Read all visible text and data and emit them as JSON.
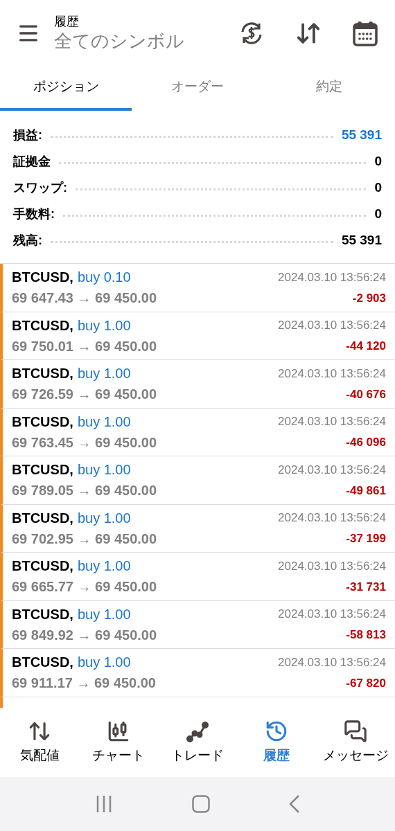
{
  "header": {
    "title": "履歴",
    "subtitle": "全てのシンボル"
  },
  "tabs": [
    {
      "label": "ポジション",
      "selected": true
    },
    {
      "label": "オーダー",
      "selected": false
    },
    {
      "label": "約定",
      "selected": false
    }
  ],
  "summary": [
    {
      "label": "損益:",
      "value": "55 391",
      "color": "#1976d2"
    },
    {
      "label": "証拠金",
      "value": "0",
      "color": "#000000"
    },
    {
      "label": "スワップ:",
      "value": "0",
      "color": "#000000"
    },
    {
      "label": "手数料:",
      "value": "0",
      "color": "#000000"
    },
    {
      "label": "残高:",
      "value": "55 391",
      "color": "#000000"
    }
  ],
  "deals": [
    {
      "symbol": "BTCUSD,",
      "side": "buy 0.10",
      "prices": "69 647.43 → 69 450.00",
      "time": "2024.03.10 13:56:24",
      "profit": "-2 903"
    },
    {
      "symbol": "BTCUSD,",
      "side": "buy 1.00",
      "prices": "69 750.01 → 69 450.00",
      "time": "2024.03.10 13:56:24",
      "profit": "-44 120"
    },
    {
      "symbol": "BTCUSD,",
      "side": "buy 1.00",
      "prices": "69 726.59 → 69 450.00",
      "time": "2024.03.10 13:56:24",
      "profit": "-40 676"
    },
    {
      "symbol": "BTCUSD,",
      "side": "buy 1.00",
      "prices": "69 763.45 → 69 450.00",
      "time": "2024.03.10 13:56:24",
      "profit": "-46 096"
    },
    {
      "symbol": "BTCUSD,",
      "side": "buy 1.00",
      "prices": "69 789.05 → 69 450.00",
      "time": "2024.03.10 13:56:24",
      "profit": "-49 861"
    },
    {
      "symbol": "BTCUSD,",
      "side": "buy 1.00",
      "prices": "69 702.95 → 69 450.00",
      "time": "2024.03.10 13:56:24",
      "profit": "-37 199"
    },
    {
      "symbol": "BTCUSD,",
      "side": "buy 1.00",
      "prices": "69 665.77 → 69 450.00",
      "time": "2024.03.10 13:56:24",
      "profit": "-31 731"
    },
    {
      "symbol": "BTCUSD,",
      "side": "buy 1.00",
      "prices": "69 849.92 → 69 450.00",
      "time": "2024.03.10 13:56:24",
      "profit": "-58 813"
    },
    {
      "symbol": "BTCUSD,",
      "side": "buy 1.00",
      "prices": "69 911.17 → 69 450.00",
      "time": "2024.03.10 13:56:24",
      "profit": "-67 820"
    }
  ],
  "nav": [
    {
      "label": "気配値",
      "kind": "quotes",
      "selected": false
    },
    {
      "label": "チャート",
      "kind": "chart",
      "selected": false
    },
    {
      "label": "トレード",
      "kind": "trade",
      "selected": false
    },
    {
      "label": "履歴",
      "kind": "history",
      "selected": true
    },
    {
      "label": "メッセージ",
      "kind": "messages",
      "selected": false
    }
  ]
}
